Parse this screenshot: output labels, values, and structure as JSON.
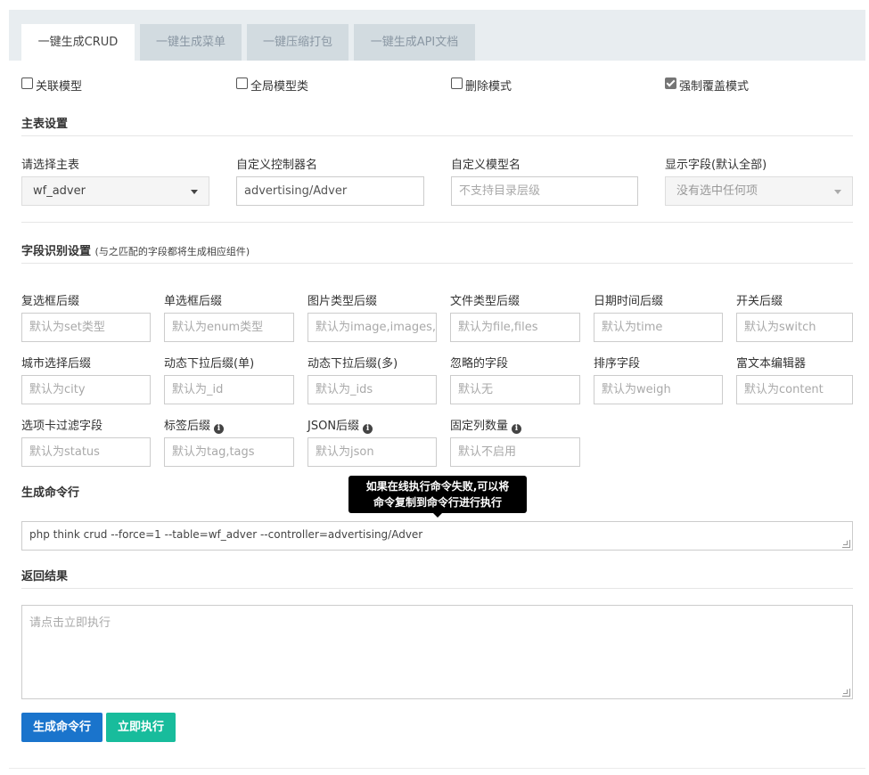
{
  "tabs": [
    {
      "label": "一键生成CRUD",
      "active": true
    },
    {
      "label": "一键生成菜单",
      "active": false
    },
    {
      "label": "一键压缩打包",
      "active": false
    },
    {
      "label": "一键生成API文档",
      "active": false
    }
  ],
  "options": [
    {
      "label": "关联模型",
      "checked": false
    },
    {
      "label": "全局模型类",
      "checked": false
    },
    {
      "label": "删除模式",
      "checked": false
    },
    {
      "label": "强制覆盖模式",
      "checked": true
    }
  ],
  "main_settings": {
    "title": "主表设置",
    "table_label": "请选择主表",
    "table_value": "wf_adver",
    "controller_label": "自定义控制器名",
    "controller_value": "advertising/Adver",
    "model_label": "自定义模型名",
    "model_placeholder": "不支持目录层级",
    "fields_label": "显示字段(默认全部)",
    "fields_value": "没有选中任何项"
  },
  "field_settings": {
    "title": "字段识别设置",
    "subtitle": "(与之匹配的字段都将生成相应组件)",
    "fields": [
      {
        "label": "复选框后缀",
        "placeholder": "默认为set类型"
      },
      {
        "label": "单选框后缀",
        "placeholder": "默认为enum类型"
      },
      {
        "label": "图片类型后缀",
        "placeholder": "默认为image,images,avatar,avatars"
      },
      {
        "label": "文件类型后缀",
        "placeholder": "默认为file,files"
      },
      {
        "label": "日期时间后缀",
        "placeholder": "默认为time"
      },
      {
        "label": "开关后缀",
        "placeholder": "默认为switch"
      },
      {
        "label": "城市选择后缀",
        "placeholder": "默认为city"
      },
      {
        "label": "动态下拉后缀(单)",
        "placeholder": "默认为_id"
      },
      {
        "label": "动态下拉后缀(多)",
        "placeholder": "默认为_ids"
      },
      {
        "label": "忽略的字段",
        "placeholder": "默认无"
      },
      {
        "label": "排序字段",
        "placeholder": "默认为weigh"
      },
      {
        "label": "富文本编辑器",
        "placeholder": "默认为content"
      },
      {
        "label": "选项卡过滤字段",
        "placeholder": "默认为status"
      },
      {
        "label": "标签后缀",
        "placeholder": "默认为tag,tags",
        "info": true
      },
      {
        "label": "JSON后缀",
        "placeholder": "默认为json",
        "info": true
      },
      {
        "label": "固定列数量",
        "placeholder": "默认不启用",
        "info": true
      }
    ]
  },
  "command": {
    "title": "生成命令行",
    "value": "php think crud --force=1 --table=wf_adver --controller=advertising/Adver",
    "tooltip_line1": "如果在线执行命令失败,可以将",
    "tooltip_line2": "命令复制到命令行进行执行"
  },
  "result": {
    "title": "返回结果",
    "placeholder": "请点击立即执行"
  },
  "buttons": {
    "generate": "生成命令行",
    "execute": "立即执行"
  },
  "colors": {
    "generate_button": "#1a74cc",
    "execute_button": "#18bc9c"
  }
}
